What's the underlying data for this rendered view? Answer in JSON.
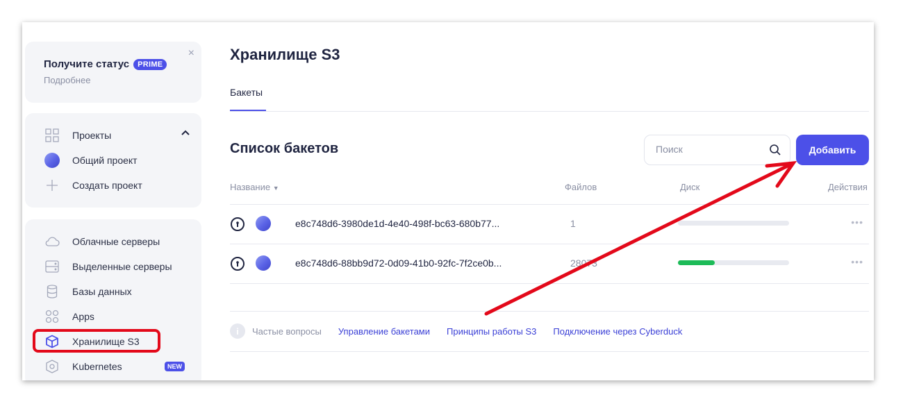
{
  "promo": {
    "title": "Получите статус",
    "badge": "PRIME",
    "subtitle": "Подробнее",
    "close": "×"
  },
  "sidebar": {
    "projects": [
      {
        "label": "Проекты"
      },
      {
        "label": "Общий проект"
      },
      {
        "label": "Создать проект"
      }
    ],
    "services": [
      {
        "label": "Облачные серверы"
      },
      {
        "label": "Выделенные серверы"
      },
      {
        "label": "Базы данных"
      },
      {
        "label": "Apps"
      },
      {
        "label": "Хранилище S3"
      },
      {
        "label": "Kubernetes",
        "badge": "NEW"
      }
    ]
  },
  "main": {
    "title": "Хранилище S3",
    "tab": "Бакеты",
    "list_title": "Список бакетов",
    "search_placeholder": "Поиск",
    "add_label": "Добавить",
    "columns": {
      "name": "Название",
      "files": "Файлов",
      "disk": "Диск",
      "actions": "Действия"
    },
    "rows": [
      {
        "name": "e8c748d6-3980de1d-4e40-498f-bc63-680b77...",
        "files": "1",
        "disk_fill": 0
      },
      {
        "name": "e8c748d6-88bb9d72-0d09-41b0-92fc-7f2ce0b...",
        "files": "28073",
        "disk_fill": 0.33
      }
    ],
    "row_menu": "•••",
    "footer": {
      "faq": "Частые вопросы",
      "links": [
        "Управление бакетами",
        "Принципы работы S3",
        "Подключение через Cyberduck"
      ]
    }
  },
  "colors": {
    "accent": "#4c50e8",
    "highlight": "#e3091a",
    "disk_fill": "#1dbb58"
  }
}
